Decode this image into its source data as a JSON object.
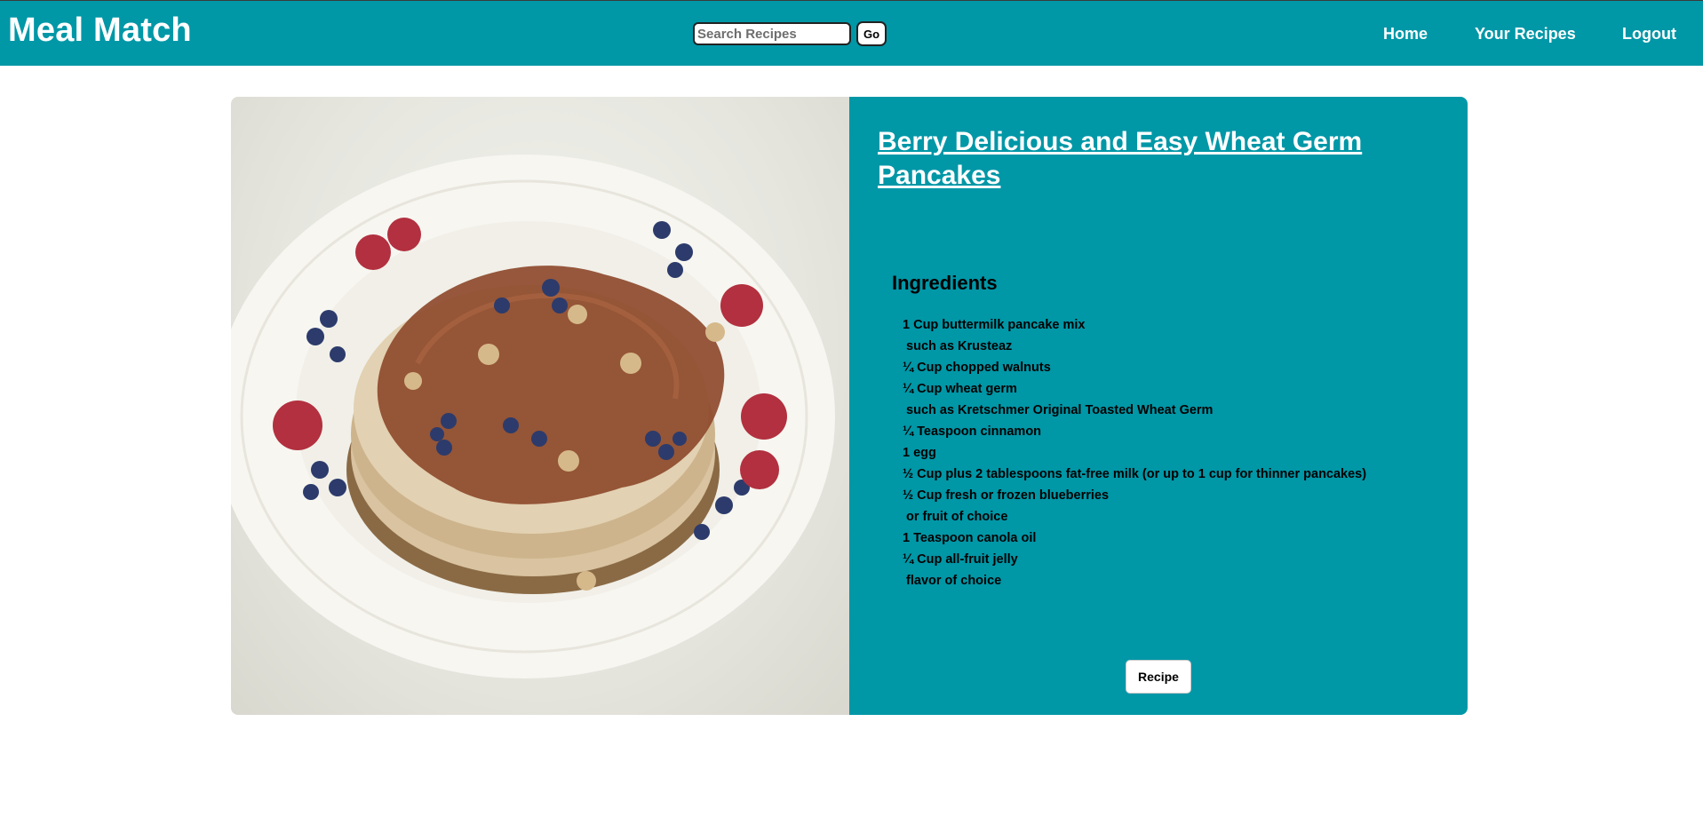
{
  "header": {
    "brand": "Meal Match",
    "search": {
      "placeholder": "Search Recipes",
      "value": "",
      "button_label": "Go"
    },
    "nav": {
      "home": "Home",
      "your_recipes": "Your Recipes",
      "logout": "Logout"
    }
  },
  "recipe": {
    "title": "Berry Delicious and Easy Wheat Germ Pancakes",
    "ingredients_heading": "Ingredients",
    "ingredients": [
      "1 Cup buttermilk pancake mix",
      " such as Krusteaz",
      "¼ Cup chopped walnuts",
      "¼ Cup wheat germ",
      " such as Kretschmer Original Toasted Wheat Germ",
      "¼ Teaspoon cinnamon",
      "1 egg",
      "½ Cup plus 2 tablespoons fat-free milk (or up to 1 cup for thinner pancakes)",
      "½ Cup fresh or frozen blueberries",
      " or fruit of choice",
      "1 Teaspoon canola oil",
      "¼ Cup all-fruit jelly",
      " flavor of choice"
    ],
    "recipe_button": "Recipe",
    "image_subject": "pancakes-with-berries-photo"
  },
  "colors": {
    "brand_teal": "#0097a7",
    "text_white": "#ffffff"
  }
}
